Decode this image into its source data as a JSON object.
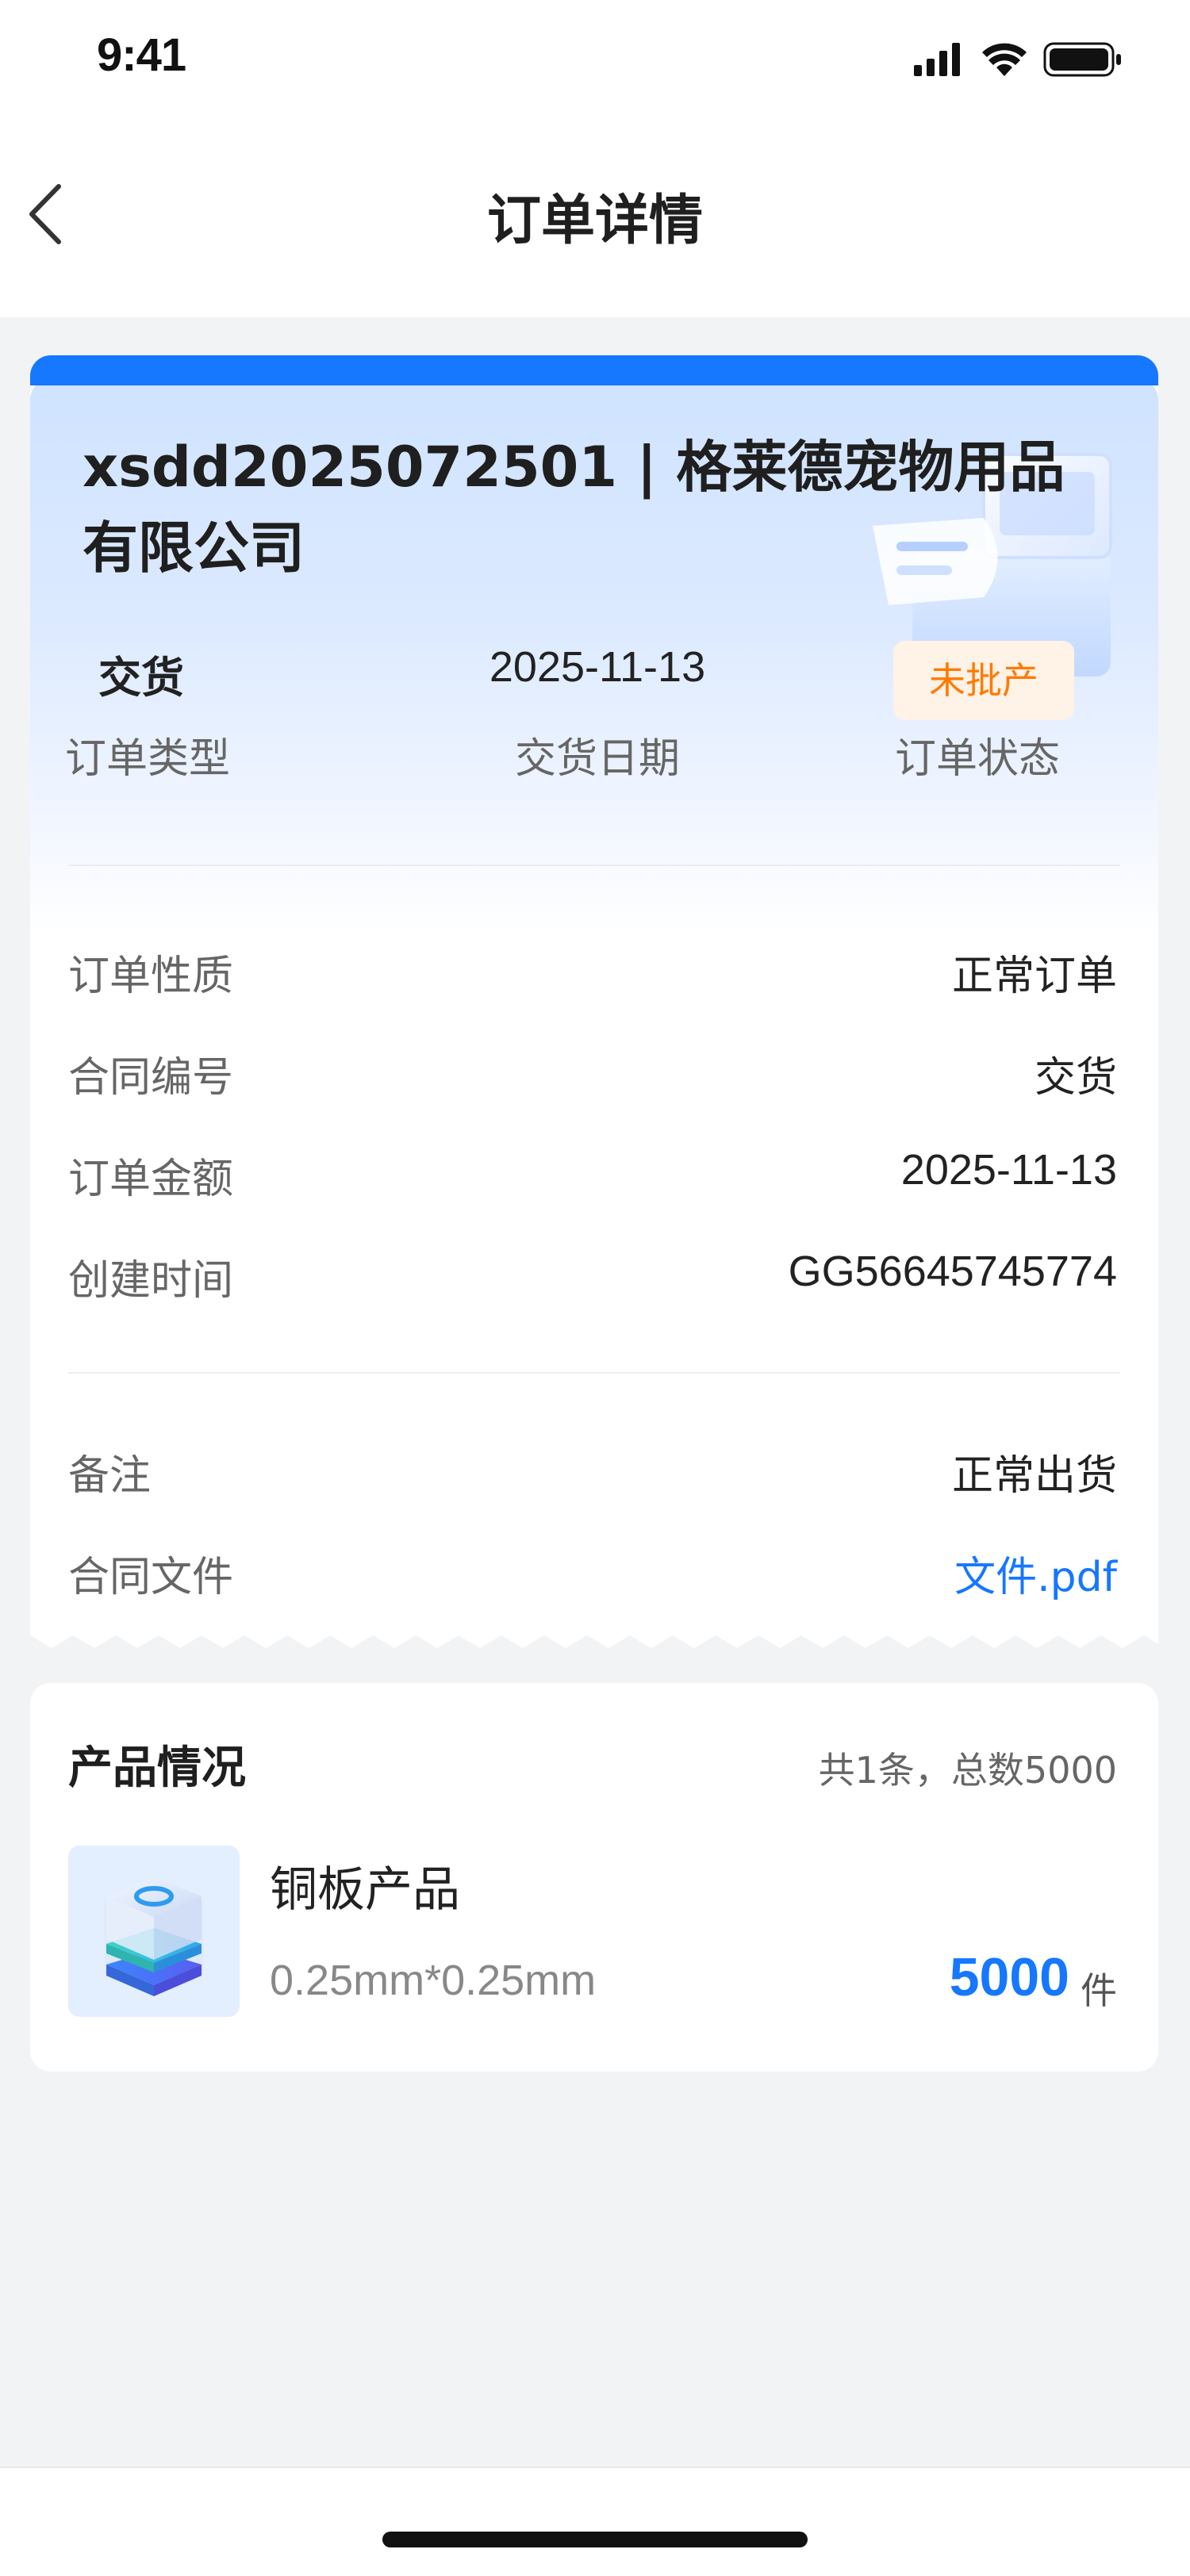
{
  "status_bar": {
    "time": "9:41",
    "icons": [
      "signal-icon",
      "wifi-icon",
      "battery-icon"
    ]
  },
  "nav": {
    "back_icon": "chevron-left-icon",
    "title": "订单详情"
  },
  "order": {
    "title": "xsdd2025072501 | 格莱德宠物用品有限公司",
    "type_value": "交货",
    "type_label": "订单类型",
    "delivery_date_value": "2025-11-13",
    "delivery_date_label": "交货日期",
    "status_value": "未批产",
    "status_label": "订单状态",
    "details": [
      {
        "label": "订单性质",
        "value": "正常订单"
      },
      {
        "label": "合同编号",
        "value": "交货"
      },
      {
        "label": "订单金额",
        "value": "2025-11-13"
      },
      {
        "label": "创建时间",
        "value": "GG56645745774"
      }
    ],
    "notes": {
      "label": "备注",
      "value": "正常出货"
    },
    "contract_file": {
      "label": "合同文件",
      "value": "文件.pdf"
    }
  },
  "products": {
    "title": "产品情况",
    "summary": "共1条，总数5000",
    "items": [
      {
        "name": "铜板产品",
        "spec": "0.25mm*0.25mm",
        "quantity": "5000",
        "unit": "件",
        "icon": "product-cube-icon"
      }
    ]
  },
  "colors": {
    "accent": "#1677FF",
    "status_text": "#FF7A00",
    "status_bg": "#FFF2E6",
    "page_bg": "#F2F3F5"
  }
}
